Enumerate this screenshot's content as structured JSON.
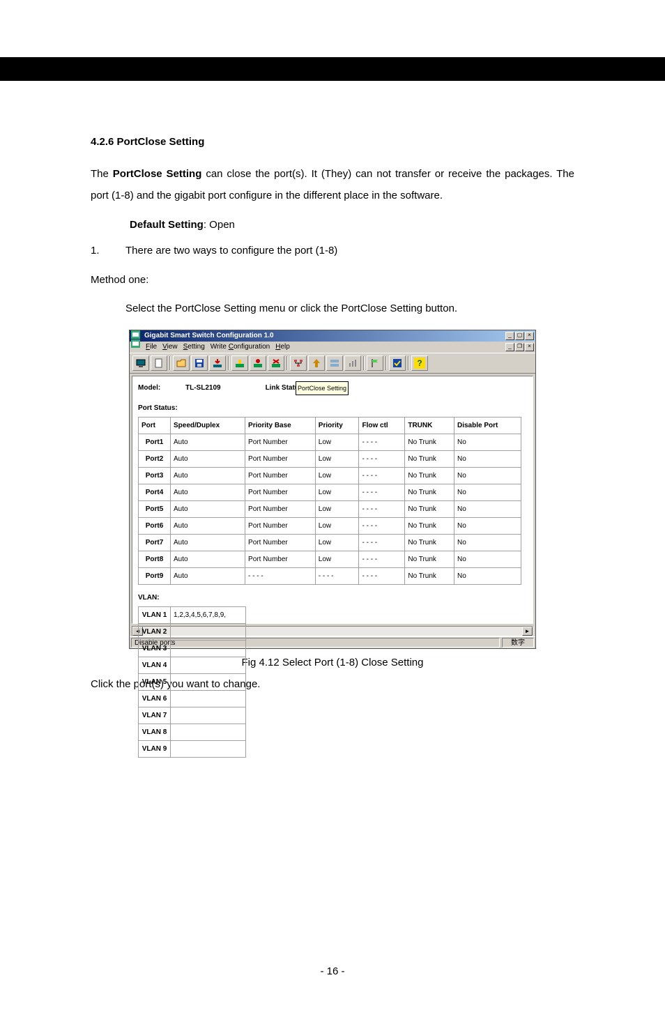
{
  "section_heading": "4.2.6 PortClose Setting",
  "para1_a": "The ",
  "para1_bold": "PortClose Setting",
  "para1_b": " can close the port(s). It (They) can not transfer or receive the packages. The port (1-8) and the gigabit port configure in the different place in the software.",
  "default_label_bold": "Default Setting",
  "default_label_after": ": Open",
  "list_num": "1.",
  "list_text": "There are two ways to configure the port (1-8)",
  "method_one": "Method one:",
  "select_line": "Select the PortClose Setting menu or click the PortClose Setting button.",
  "window": {
    "title": "Gigabit Smart Switch Configuration 1.0",
    "menus": {
      "file": "File",
      "view": "View",
      "setting": "Setting",
      "writeconfig": "Write Configuration",
      "help": "Help"
    },
    "model_label": "Model:",
    "model_value": "TL-SL2109",
    "link_status_label": "Link Status",
    "tooltip": "PortClose Setting",
    "port_status_label": "Port Status:",
    "headers": {
      "port": "Port",
      "speed": "Speed/Duplex",
      "priobase": "Priority Base",
      "priority": "Priority",
      "flow": "Flow ctl",
      "trunk": "TRUNK",
      "disable": "Disable Port"
    },
    "rows": [
      {
        "port": "Port1",
        "speed": "Auto",
        "priobase": "Port Number",
        "priority": "Low",
        "flow": "- - - -",
        "trunk": "No Trunk",
        "disable": "No"
      },
      {
        "port": "Port2",
        "speed": "Auto",
        "priobase": "Port Number",
        "priority": "Low",
        "flow": "- - - -",
        "trunk": "No Trunk",
        "disable": "No"
      },
      {
        "port": "Port3",
        "speed": "Auto",
        "priobase": "Port Number",
        "priority": "Low",
        "flow": "- - - -",
        "trunk": "No Trunk",
        "disable": "No"
      },
      {
        "port": "Port4",
        "speed": "Auto",
        "priobase": "Port Number",
        "priority": "Low",
        "flow": "- - - -",
        "trunk": "No Trunk",
        "disable": "No"
      },
      {
        "port": "Port5",
        "speed": "Auto",
        "priobase": "Port Number",
        "priority": "Low",
        "flow": "- - - -",
        "trunk": "No Trunk",
        "disable": "No"
      },
      {
        "port": "Port6",
        "speed": "Auto",
        "priobase": "Port Number",
        "priority": "Low",
        "flow": "- - - -",
        "trunk": "No Trunk",
        "disable": "No"
      },
      {
        "port": "Port7",
        "speed": "Auto",
        "priobase": "Port Number",
        "priority": "Low",
        "flow": "- - - -",
        "trunk": "No Trunk",
        "disable": "No"
      },
      {
        "port": "Port8",
        "speed": "Auto",
        "priobase": "Port Number",
        "priority": "Low",
        "flow": "- - - -",
        "trunk": "No Trunk",
        "disable": "No"
      },
      {
        "port": "Port9",
        "speed": "Auto",
        "priobase": "- - - -",
        "priority": "- - - -",
        "flow": "- - - -",
        "trunk": "No Trunk",
        "disable": "No"
      }
    ],
    "vlan_label": "VLAN:",
    "vlans": [
      {
        "name": "VLAN 1",
        "members": "1,2,3,4,5,6,7,8,9,"
      },
      {
        "name": "VLAN 2",
        "members": ""
      },
      {
        "name": "VLAN 3",
        "members": ""
      },
      {
        "name": "VLAN 4",
        "members": ""
      },
      {
        "name": "VLAN 5",
        "members": ""
      },
      {
        "name": "VLAN 6",
        "members": ""
      },
      {
        "name": "VLAN 7",
        "members": ""
      },
      {
        "name": "VLAN 8",
        "members": ""
      },
      {
        "name": "VLAN 9",
        "members": ""
      }
    ],
    "status_left": "Disable ports",
    "status_right": "数字"
  },
  "fig_caption": "Fig 4.12 Select Port (1-8) Close Setting",
  "click_line": "Click the port(s) you want to change.",
  "page_num": "- 16 -"
}
